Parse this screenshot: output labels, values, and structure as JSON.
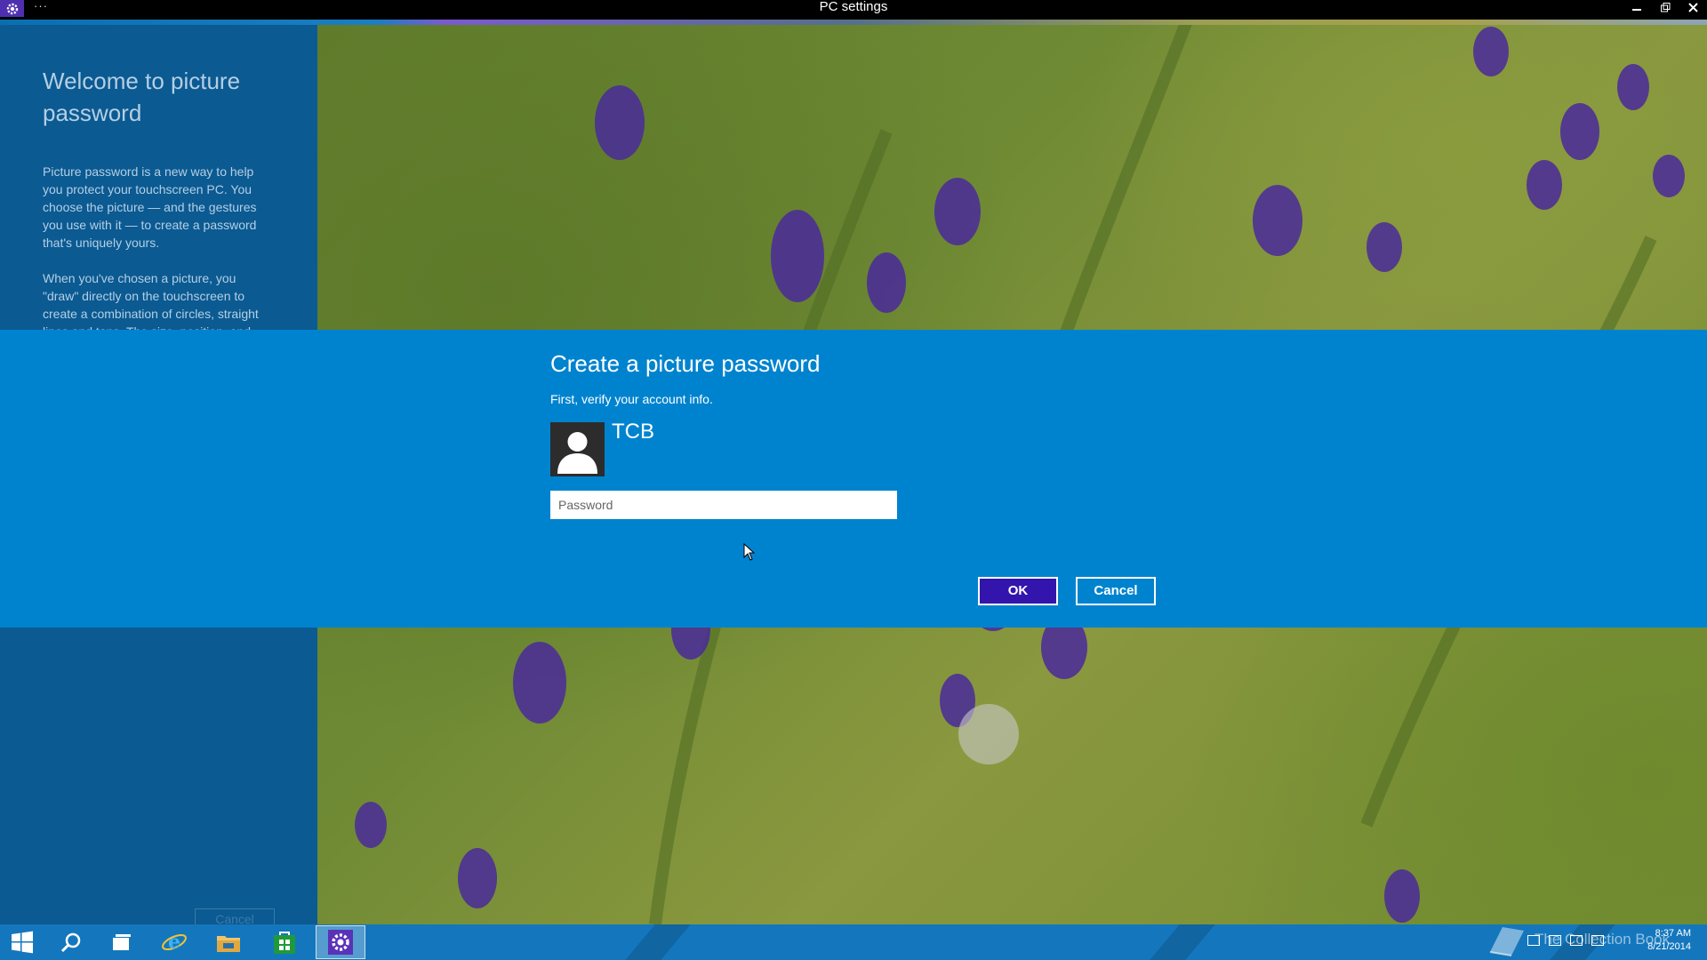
{
  "window": {
    "title": "PC settings",
    "menu_glyph": "···",
    "app_icon": "gear-icon",
    "controls": [
      "minimize-icon",
      "restore-icon",
      "close-icon"
    ]
  },
  "left_pane": {
    "title": "Welcome to picture password",
    "paragraphs": [
      "Picture password is a new way to help you protect your touchscreen PC. You choose the picture — and the gestures you use with it — to create a password that's uniquely yours.",
      "When you've chosen a picture, you \"draw\" directly on the touchscreen to create a combination of circles, straight lines and taps. The size, position, and"
    ],
    "cancel_label": "Cancel"
  },
  "dialog": {
    "title": "Create a picture password",
    "subtitle": "First, verify your account info.",
    "username": "TCB",
    "password_placeholder": "Password",
    "password_value": "",
    "ok_label": "OK",
    "cancel_label": "Cancel"
  },
  "taskbar": {
    "items": [
      "start-icon",
      "search-icon",
      "task-view-icon",
      "internet-explorer-icon",
      "file-explorer-icon",
      "store-icon",
      "settings-icon"
    ],
    "active_item": "settings-icon",
    "clock": "8:37 AM",
    "date": "8/21/2014",
    "watermark": "The Collection Book"
  },
  "colors": {
    "dialog_band": "#0083cf",
    "left_pane": "#0b5a92",
    "ok_button": "#3315ad",
    "taskbar": "#1477bd"
  }
}
